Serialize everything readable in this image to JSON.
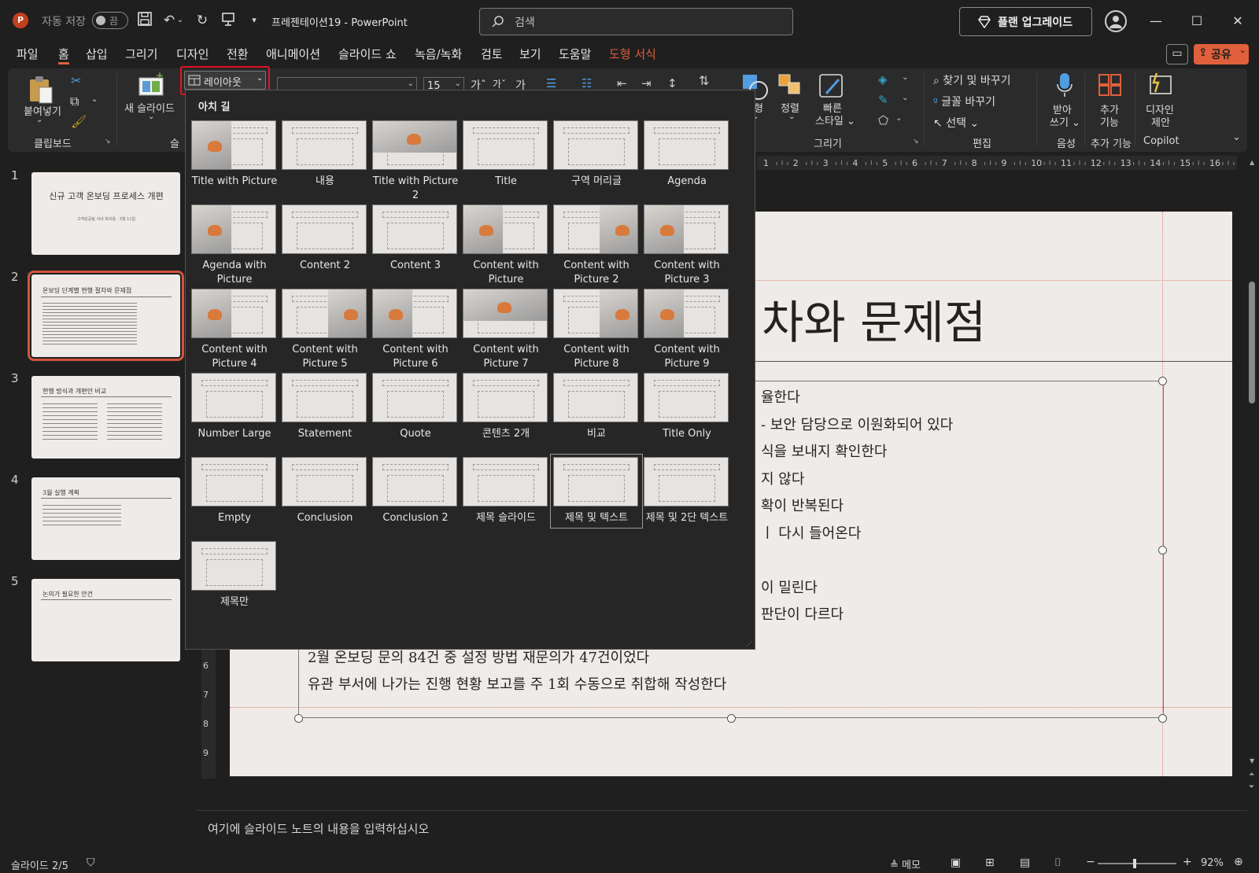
{
  "titlebar": {
    "app_icon": "P",
    "autosave_label": "자동 저장",
    "autosave_state": "끔",
    "doc_title": "프레젠테이션19  -  PowerPoint",
    "search_placeholder": "검색",
    "upgrade_label": "플랜 업그레이드"
  },
  "menu": [
    "파일",
    "홈",
    "삽입",
    "그리기",
    "디자인",
    "전환",
    "애니메이션",
    "슬라이드 쇼",
    "녹음/녹화",
    "검토",
    "보기",
    "도움말",
    "도형 서식"
  ],
  "share_label": "공유",
  "ribbon": {
    "paste": "붙여넣기",
    "clipboard": "클립보드",
    "new_slide": "새 슬라이드",
    "slides_group_partial": "슬",
    "layout_button": "레이아웃",
    "font_size": "15",
    "shape": "도형",
    "arrange": "정렬",
    "quick_style_1": "빠른",
    "quick_style_2": "스타일",
    "draw_group": "그리기",
    "find_replace": "찾기 및 바꾸기",
    "font_replace": "글꼴 바꾸기",
    "select": "선택",
    "edit_group": "편집",
    "dictate_1": "받아",
    "dictate_2": "쓰기",
    "voice_group": "음성",
    "addins_1": "추가",
    "addins_2": "기능",
    "addins_group": "추가 기능",
    "designer_1": "디자인",
    "designer_2": "제안",
    "copilot_group": "Copilot"
  },
  "ruler_ticks": [
    "1",
    "2",
    "3",
    "4",
    "5",
    "6",
    "7",
    "8",
    "9",
    "10",
    "11",
    "12",
    "13",
    "14",
    "15",
    "16"
  ],
  "vruler_ticks": [
    "6",
    "7",
    "8",
    "9"
  ],
  "thumbnails": [
    {
      "num": "1",
      "title": "신규 고객 온보딩 프로세스 개편",
      "sub": "고객성공팀 사내 회의용 · 3월 11일"
    },
    {
      "num": "2",
      "title": "온보딩 단계별 현행 절차와 문제점"
    },
    {
      "num": "3",
      "title": "현행 방식과 개편안 비교"
    },
    {
      "num": "4",
      "title": "3월 실행 계획"
    },
    {
      "num": "5",
      "title": "논의가 필요한 안건"
    }
  ],
  "slide": {
    "title_visible": "차와 문제점",
    "bullets_partial": [
      "율한다",
      "- 보안 담당으로 이원화되어 있다",
      "식을 보내지 확인한다",
      "지 않다",
      "확이 반복된다",
      "ㅣ 다시 들어온다",
      "",
      "이 밀린다",
      "판단이 다르다"
    ],
    "bullet_full_1": "2월 온보딩 문의 84건 중 설정 방법 재문의가 47건이었다",
    "bullet_full_2": "유관 부서에 나가는 진행 현황 보고를 주 1회 수동으로 취합해 작성한다"
  },
  "layout_gallery": {
    "section": "아치 길",
    "items": [
      "Title with Picture",
      "내용",
      "Title with Picture 2",
      "Title",
      "구역 머리글",
      "Agenda",
      "Agenda with Picture",
      "Content 2",
      "Content 3",
      "Content with Picture",
      "Content with Picture 2",
      "Content with Picture 3",
      "Content with Picture 4",
      "Content with Picture 5",
      "Content with Picture 6",
      "Content with Picture 7",
      "Content with Picture 8",
      "Content with Picture 9",
      "Number Large",
      "Statement",
      "Quote",
      "콘텐츠 2개",
      "비교",
      "Title Only",
      "Empty",
      "Conclusion",
      "Conclusion 2",
      "제목 슬라이드",
      "제목 및 텍스트",
      "제목 및 2단 텍스트",
      "제목만"
    ],
    "selected": "제목 및 텍스트"
  },
  "notes_placeholder": "여기에 슬라이드 노트의 내용을 입력하십시오",
  "status": {
    "slide_info": "슬라이드 2/5",
    "notes": "메모",
    "zoom": "92%"
  },
  "colors": {
    "accent": "#e0603b",
    "highlight_red": "#e81123",
    "slide_bg": "#efebe8"
  }
}
